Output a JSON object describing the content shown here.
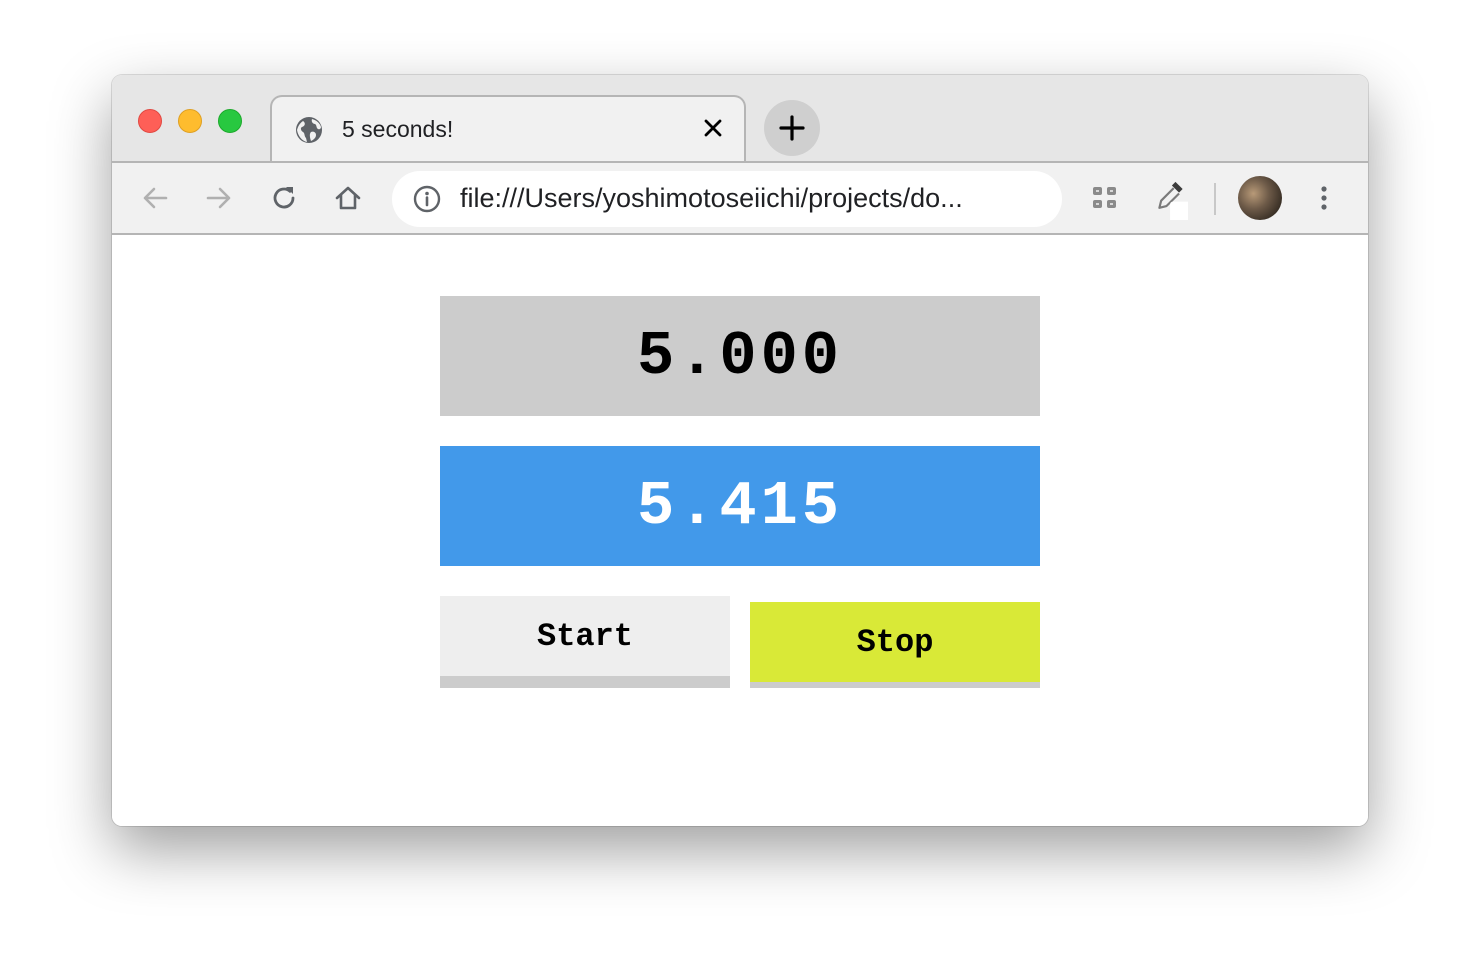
{
  "window": {
    "traffic_lights": [
      "close",
      "minimize",
      "maximize"
    ]
  },
  "tab": {
    "title": "5 seconds!",
    "favicon": "globe-icon",
    "close_icon": "close-icon"
  },
  "newtab": {
    "icon": "plus-icon"
  },
  "toolbar": {
    "back_icon": "arrow-left-icon",
    "forward_icon": "arrow-right-icon",
    "reload_icon": "reload-icon",
    "home_icon": "home-icon",
    "url": "file:///Users/yoshimotoseiichi/projects/do...",
    "info_icon": "info-icon",
    "extension_icons": [
      "extension-grid-icon",
      "eyedropper-icon"
    ],
    "menu_icon": "more-vert-icon"
  },
  "app": {
    "target_time": "5.000",
    "elapsed_time": "5.415",
    "start_label": "Start",
    "stop_label": "Stop"
  },
  "colors": {
    "target_bg": "#cccccc",
    "result_bg": "#4299ea",
    "start_bg": "#eeeeee",
    "stop_bg": "#d9e937"
  }
}
